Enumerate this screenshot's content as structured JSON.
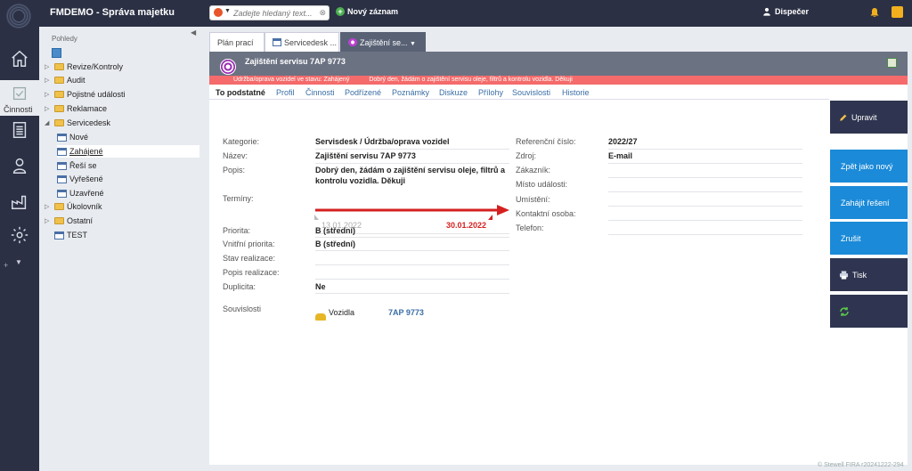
{
  "app": {
    "title": "FMDEMO - Správa majetku"
  },
  "topbar": {
    "search_placeholder": "Zadejte hledaný text...",
    "new_record": "Nový záznam",
    "user": "Dispečer"
  },
  "rail": {
    "active_label": "Činnosti"
  },
  "sidebar": {
    "header": "Pohledy",
    "items": [
      {
        "label": "Revize/Kontroly",
        "type": "folder"
      },
      {
        "label": "Audit",
        "type": "folder"
      },
      {
        "label": "Pojistné události",
        "type": "folder"
      },
      {
        "label": "Reklamace",
        "type": "folder"
      },
      {
        "label": "Servicedesk",
        "type": "folder",
        "expanded": true
      },
      {
        "label": "Nové",
        "type": "view"
      },
      {
        "label": "Zahájené",
        "type": "view",
        "selected": true
      },
      {
        "label": "Řeší se",
        "type": "view"
      },
      {
        "label": "Vyřešené",
        "type": "view"
      },
      {
        "label": "Uzavřené",
        "type": "view"
      },
      {
        "label": "Úkolovník",
        "type": "folder"
      },
      {
        "label": "Ostatní",
        "type": "folder"
      },
      {
        "label": "TEST",
        "type": "view"
      }
    ]
  },
  "window_tabs": [
    {
      "label": "Plán prací"
    },
    {
      "label": "Servicedesk ..."
    },
    {
      "label": "Zajištění se...",
      "active": true
    }
  ],
  "record": {
    "title": "Zajištění servisu 7AP 9773",
    "status_line_1": "Údržba/oprava vozidel ve stavu: Zahájený",
    "status_line_2": "Dobrý den, žádám o zajištění servisu oleje, filtrů a kontrolu vozidla. Děkuji",
    "subtabs": [
      "To podstatné",
      "Profil",
      "Činnosti",
      "Podřízené",
      "Poznámky",
      "Diskuze",
      "Přílohy",
      "Souvislosti",
      "Historie"
    ],
    "fields_left": {
      "kategorie_label": "Kategorie:",
      "kategorie": "Servisdesk / Údržba/oprava vozidel",
      "nazev_label": "Název:",
      "nazev": "Zajištění servisu 7AP 9773",
      "popis_label": "Popis:",
      "popis_line1": "Dobrý den, žádám o zajištění servisu oleje, filtrů a",
      "popis_line2": "kontrolu vozidla. Děkuji",
      "terminy_label": "Termíny:",
      "date_start": "13.01.2022",
      "date_end": "30.01.2022",
      "priorita_label": "Priorita:",
      "priorita": "B (střední)",
      "vnitrni_label": "Vnitřní priorita:",
      "vnitrni": "B (střední)",
      "stav_label": "Stav realizace:",
      "popis_real_label": "Popis realizace:",
      "duplicita_label": "Duplicita:",
      "duplicita": "Ne",
      "souvislosti_label": "Souvislosti",
      "rel_type": "Vozidla",
      "rel_value": "7AP 9773"
    },
    "fields_right": {
      "ref_label": "Referenční číslo:",
      "ref": "2022/27",
      "zdroj_label": "Zdroj:",
      "zdroj": "E-mail",
      "zakaznik_label": "Zákazník:",
      "misto_label": "Místo události:",
      "umisteni_label": "Umístění:",
      "kontakt_label": "Kontaktní osoba:",
      "telefon_label": "Telefon:"
    }
  },
  "actions": {
    "upravit": "Upravit",
    "zpet": "Zpět jako nový",
    "zahajit": "Zahájit řešení",
    "zrusit": "Zrušit",
    "tisk": "Tisk"
  },
  "footer": "© Stewell FIRA r20241222-294"
}
